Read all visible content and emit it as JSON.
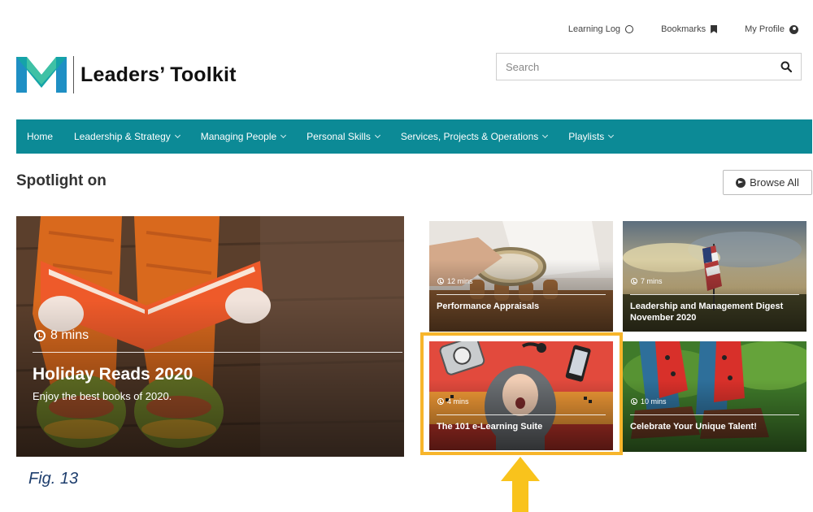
{
  "header": {
    "links": [
      {
        "label": "Learning Log",
        "icon": "circle-icon"
      },
      {
        "label": "Bookmarks",
        "icon": "bookmark-icon"
      },
      {
        "label": "My Profile",
        "icon": "profile-icon"
      }
    ],
    "logo_text": "Leaders’ Toolkit",
    "search": {
      "placeholder": "Search",
      "value": ""
    }
  },
  "nav": {
    "items": [
      {
        "label": "Home",
        "dropdown": false
      },
      {
        "label": "Leadership & Strategy",
        "dropdown": true
      },
      {
        "label": "Managing People",
        "dropdown": true
      },
      {
        "label": "Personal Skills",
        "dropdown": true
      },
      {
        "label": "Services, Projects & Operations",
        "dropdown": true
      },
      {
        "label": "Playlists",
        "dropdown": true
      }
    ]
  },
  "spotlight": {
    "title": "Spotlight on",
    "browse_label": "Browse All",
    "featured": {
      "duration": "8 mins",
      "title": "Holiday Reads 2020",
      "subtitle": "Enjoy the best books of 2020."
    },
    "cards": [
      {
        "duration": "12 mins",
        "title": "Performance Appraisals"
      },
      {
        "duration": "7 mins",
        "title": "Leadership and Management Digest November 2020"
      },
      {
        "duration": "4 mins",
        "title": "The 101 e-Learning Suite"
      },
      {
        "duration": "10 mins",
        "title": "Celebrate Your Unique Talent!"
      }
    ]
  },
  "annotation": {
    "figure_label": "Fig. 13"
  },
  "colors": {
    "nav": "#0c8a96",
    "logo_teal": "#15a3a8",
    "highlight": "#f7b52b",
    "arrow": "#f9c31c"
  }
}
